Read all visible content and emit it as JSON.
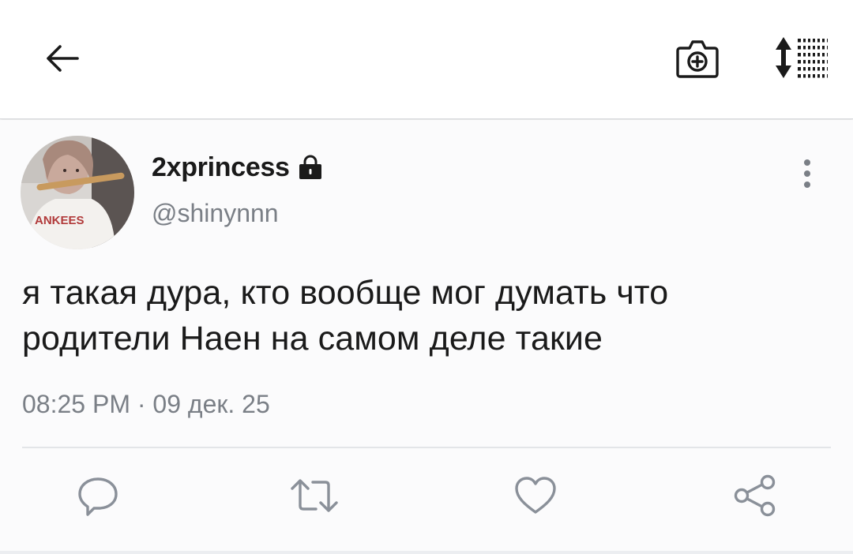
{
  "header": {
    "back_icon": "arrow-left-icon",
    "camera_icon": "camera-plus-icon",
    "sort_icon": "sort-list-icon"
  },
  "tweet": {
    "display_name": "2xprincess",
    "protected_icon": "lock-icon",
    "username": "@shinynnn",
    "text_line1": "я такая дура, кто вообще мог думать что",
    "text_line2": "родители Наен на самом деле такие",
    "timestamp": "08:25 PM · 09 дек. 25",
    "more_icon": "more-vertical-icon"
  },
  "actions": {
    "reply_icon": "reply-bubble-icon",
    "retweet_icon": "retweet-icon",
    "like_icon": "heart-icon",
    "share_icon": "share-icon"
  },
  "colors": {
    "text_primary": "#1a1a1a",
    "text_secondary": "#7a7f86",
    "icon_gray": "#8a9099",
    "divider": "#e3e5e8"
  }
}
